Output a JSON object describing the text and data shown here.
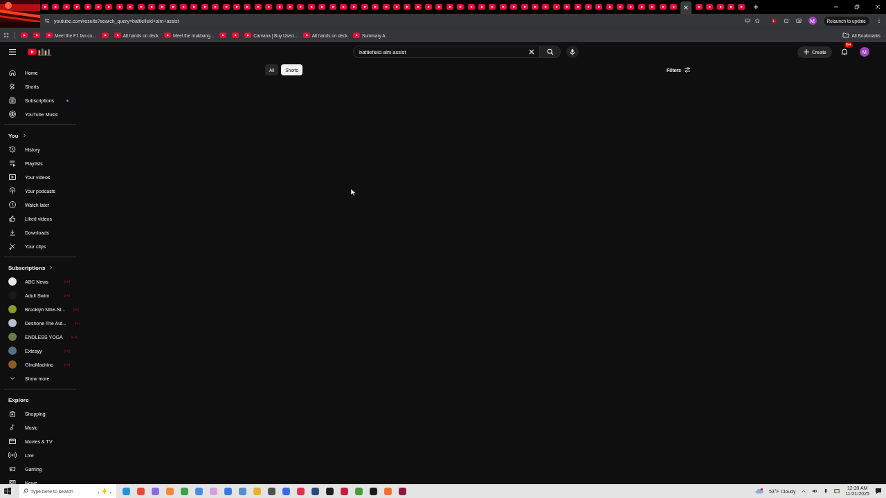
{
  "browser": {
    "url": "youtube.com/results?search_query=battlefield+aim+assist",
    "relaunch": "Relaunch to update",
    "profile": "M",
    "bookmarks": [
      {
        "kind": "icon"
      },
      {
        "kind": "icon"
      },
      {
        "kind": "link",
        "label": "Meet the F1 fan co..."
      },
      {
        "kind": "icon"
      },
      {
        "kind": "link",
        "label": "All hands on deck"
      },
      {
        "kind": "link",
        "label": "Meet the mukbang..."
      },
      {
        "kind": "icon"
      },
      {
        "kind": "icon"
      },
      {
        "kind": "link",
        "label": "Carvana | Buy Used..."
      },
      {
        "kind": "link",
        "label": "All hands on deck"
      },
      {
        "kind": "link",
        "label": "Summary A"
      }
    ],
    "all_bookmarks": "All Bookmarks"
  },
  "youtube": {
    "search_value": "battlefield aim assist",
    "create": "Create",
    "notification_count": "9+",
    "avatar": "M",
    "chips": [
      {
        "label": "All",
        "selected": false
      },
      {
        "label": "Shorts",
        "selected": true
      }
    ],
    "filters": "Filters",
    "sidebar": {
      "main": [
        {
          "label": "Home",
          "new": false
        },
        {
          "label": "Shorts",
          "new": false
        },
        {
          "label": "Subscriptions",
          "new": true
        },
        {
          "label": "YouTube Music",
          "new": false
        }
      ],
      "you_heading": "You",
      "you": [
        "History",
        "Playlists",
        "Your videos",
        "Your podcasts",
        "Watch later",
        "Liked videos",
        "Downloads",
        "Your clips"
      ],
      "subscriptions_heading": "Subscriptions",
      "channels": [
        {
          "name": "ABC News",
          "color": "#e8e8e8",
          "live": true
        },
        {
          "name": "Adult Swim",
          "color": "#1a1a1a",
          "live": true
        },
        {
          "name": "Brooklyn Nine-Ni...",
          "color": "#8a9a2a",
          "live": true
        },
        {
          "name": "Deshone The Aut...",
          "color": "#b8c0d0",
          "live": true
        },
        {
          "name": "ENDLESS YOGA",
          "color": "#6a7a4a",
          "live": true
        },
        {
          "name": "Extesyy",
          "color": "#5a7080",
          "live": true
        },
        {
          "name": "GinoMachino",
          "color": "#8a5a2a",
          "live": true
        }
      ],
      "show_more": "Show more",
      "explore_heading": "Explore",
      "explore": [
        "Shopping",
        "Music",
        "Movies & TV",
        "Live",
        "Gaming",
        "News"
      ]
    }
  },
  "taskbar": {
    "search_placeholder": "Type here to search",
    "weather": "53°F  Cloudy",
    "time": "12:39 AM",
    "date": "11/21/2025"
  }
}
